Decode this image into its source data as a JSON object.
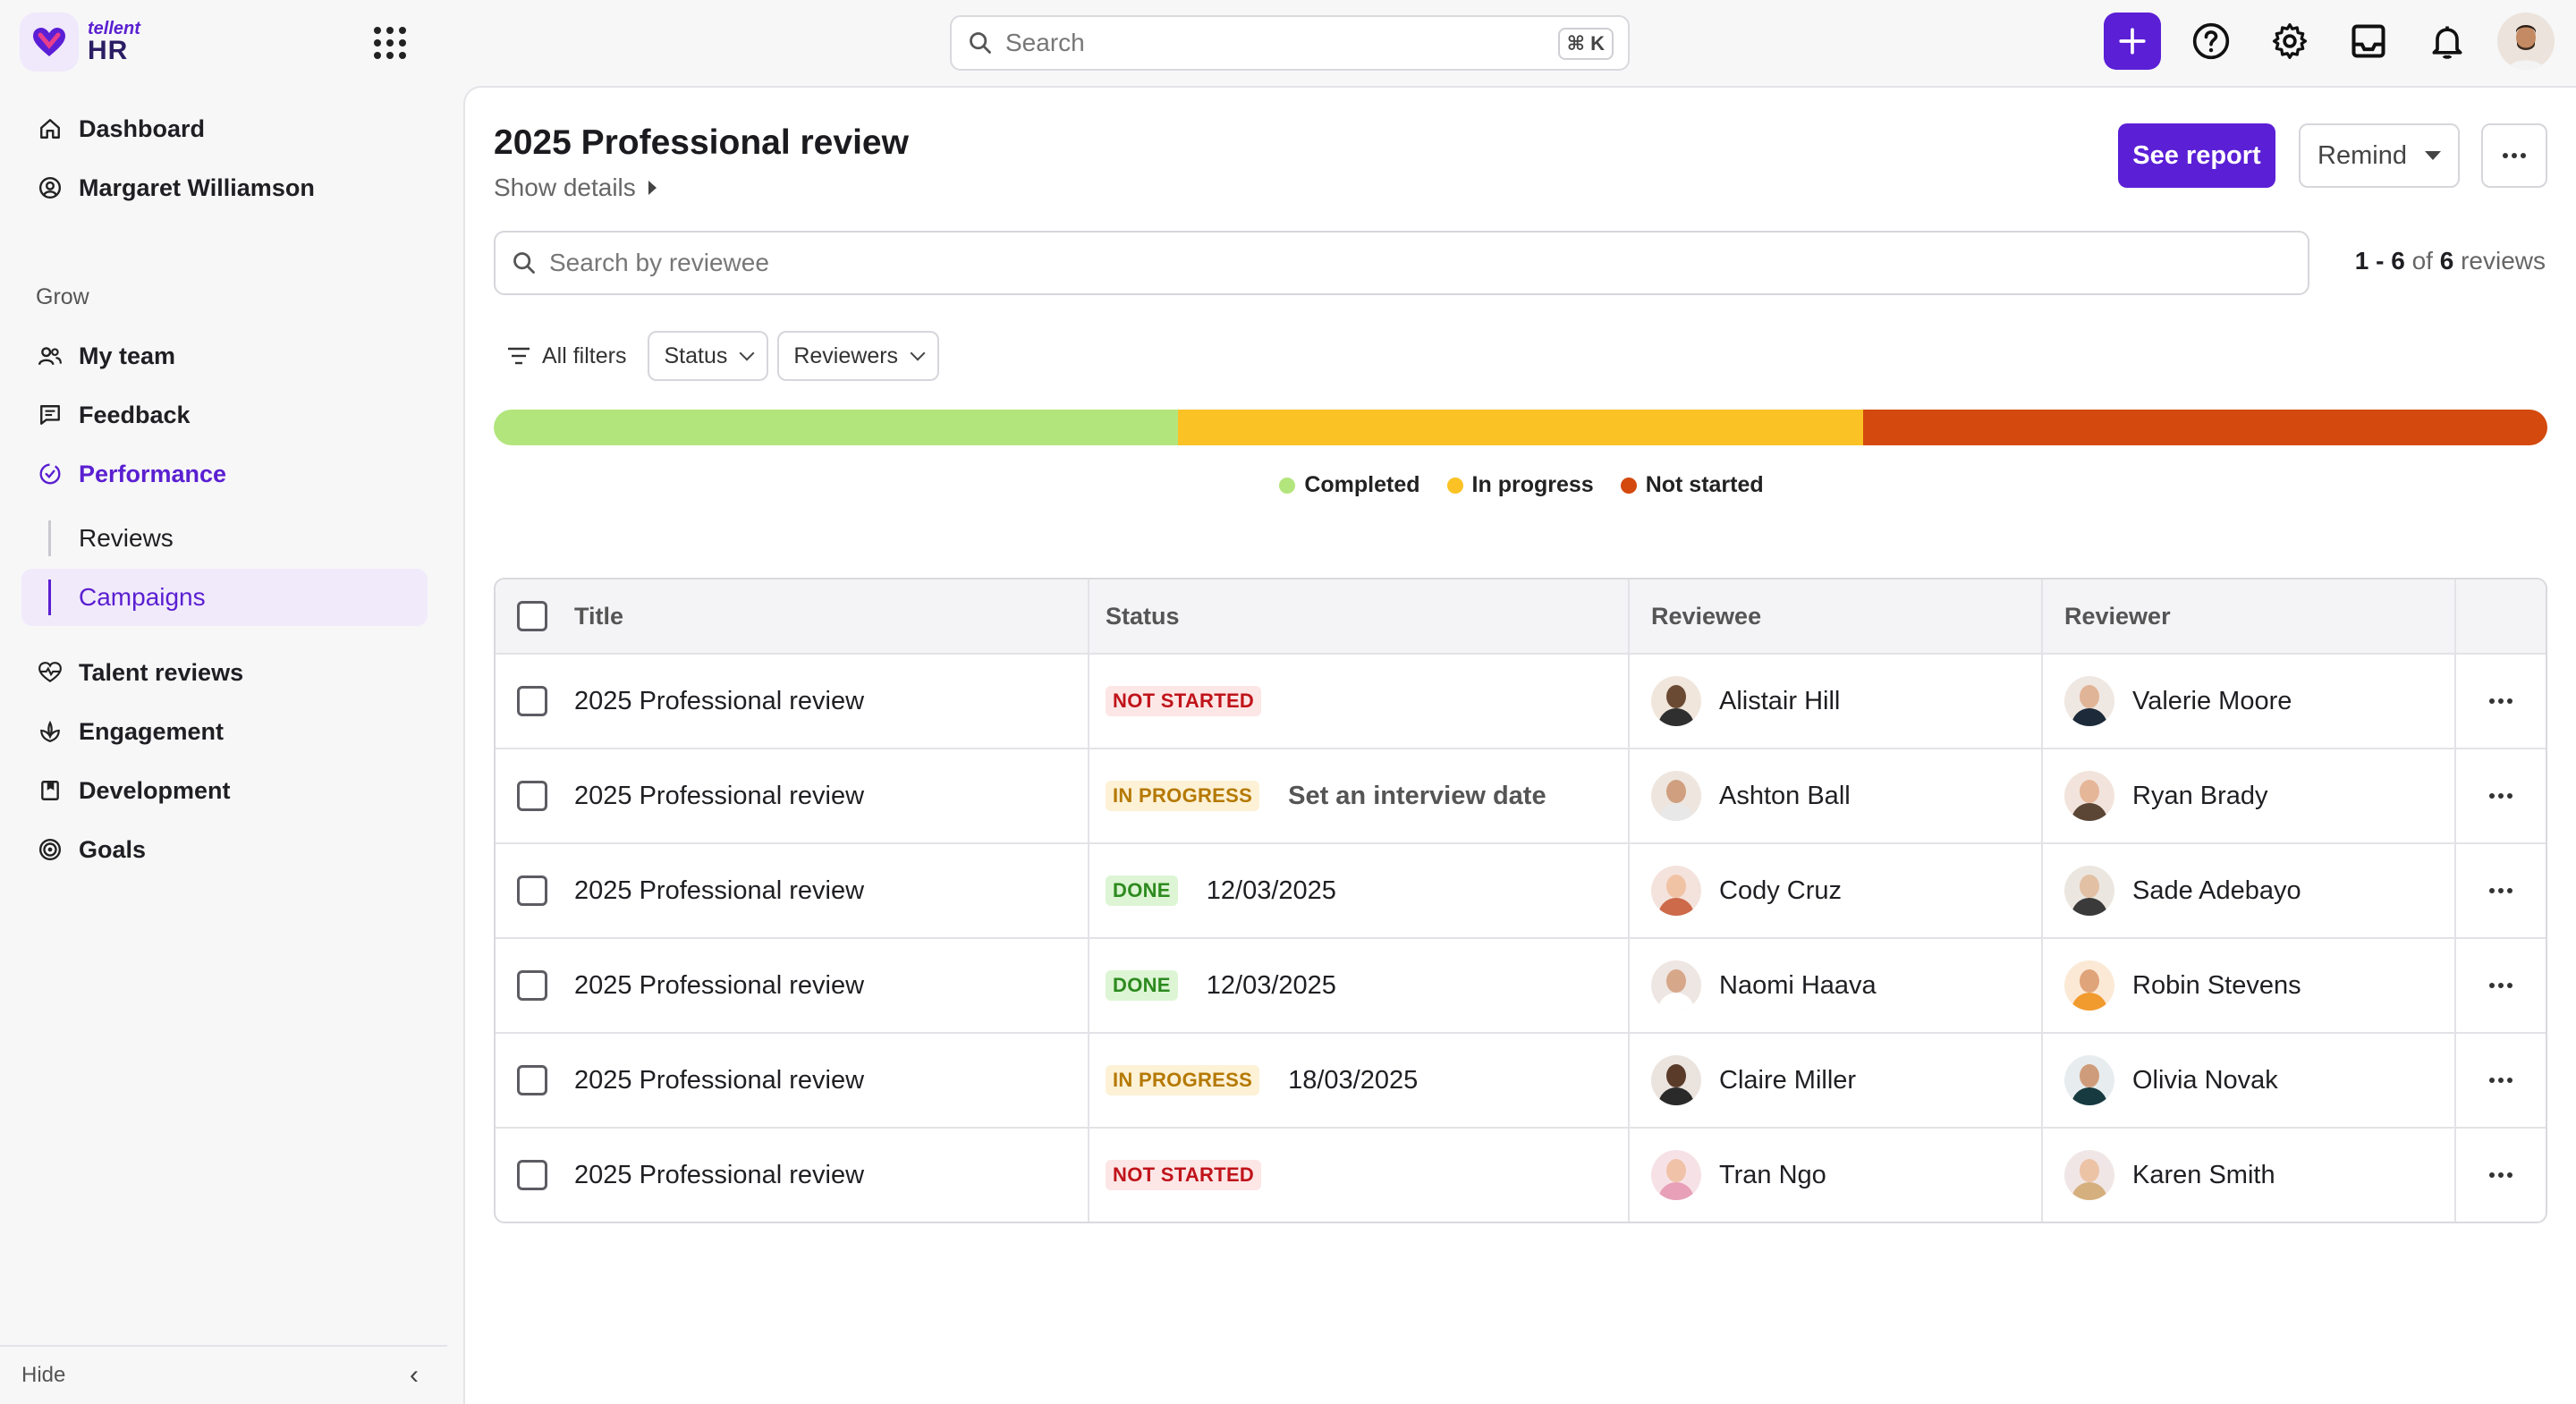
{
  "app": {
    "logo_small": "tellent",
    "logo_big": "HR"
  },
  "topbar": {
    "search_placeholder": "Search",
    "shortcut": "⌘ K"
  },
  "sidebar": {
    "top_items": [
      {
        "label": "Dashboard",
        "icon": "home-icon"
      },
      {
        "label": "Margaret Williamson",
        "icon": "user-circle-icon"
      }
    ],
    "section_label": "Grow",
    "items": [
      {
        "label": "My team",
        "icon": "team-icon"
      },
      {
        "label": "Feedback",
        "icon": "feedback-icon"
      },
      {
        "label": "Performance",
        "icon": "performance-icon"
      },
      {
        "label": "Reviews"
      },
      {
        "label": "Campaigns"
      },
      {
        "label": "Talent reviews",
        "icon": "talent-icon"
      },
      {
        "label": "Engagement",
        "icon": "engagement-icon"
      },
      {
        "label": "Development",
        "icon": "development-icon"
      },
      {
        "label": "Goals",
        "icon": "goals-icon"
      }
    ],
    "hide_label": "Hide"
  },
  "page": {
    "title": "2025 Professional review",
    "show_details": "Show details",
    "see_report": "See report",
    "remind": "Remind",
    "search_placeholder": "Search by reviewee",
    "count": {
      "range": "1 - 6",
      "of": "of",
      "total": "6",
      "unit": "reviews"
    },
    "filters": {
      "all": "All filters",
      "status": "Status",
      "reviewers": "Reviewers"
    }
  },
  "progress": {
    "segments": [
      {
        "label": "Completed",
        "fraction": 0.3333,
        "color": "#b3e57d"
      },
      {
        "label": "In progress",
        "fraction": 0.3333,
        "color": "#fbc225"
      },
      {
        "label": "Not started",
        "fraction": 0.3334,
        "color": "#d4490d"
      }
    ]
  },
  "table": {
    "headers": {
      "title": "Title",
      "status": "Status",
      "reviewee": "Reviewee",
      "reviewer": "Reviewer"
    },
    "rows": [
      {
        "title": "2025 Professional review",
        "status": "NOT STARTED",
        "status_kind": "not-started",
        "extra": "",
        "reviewee": "Alistair Hill",
        "reviewer": "Valerie Moore"
      },
      {
        "title": "2025 Professional review",
        "status": "IN PROGRESS",
        "status_kind": "in-progress",
        "extra": "Set an interview date",
        "reviewee": "Ashton Ball",
        "reviewer": "Ryan Brady"
      },
      {
        "title": "2025 Professional review",
        "status": "DONE",
        "status_kind": "done",
        "extra": "12/03/2025",
        "reviewee": "Cody Cruz",
        "reviewer": "Sade Adebayo"
      },
      {
        "title": "2025 Professional review",
        "status": "DONE",
        "status_kind": "done",
        "extra": "12/03/2025",
        "reviewee": "Naomi Haava",
        "reviewer": "Robin Stevens"
      },
      {
        "title": "2025 Professional review",
        "status": "IN PROGRESS",
        "status_kind": "in-progress",
        "extra": "18/03/2025",
        "reviewee": "Claire Miller",
        "reviewer": "Olivia Novak"
      },
      {
        "title": "2025 Professional review",
        "status": "NOT STARTED",
        "status_kind": "not-started",
        "extra": "",
        "reviewee": "Tran Ngo",
        "reviewer": "Karen Smith"
      }
    ]
  },
  "colors": {
    "accent": "#5b1fd6",
    "accent_text": "#5a1fd1"
  }
}
